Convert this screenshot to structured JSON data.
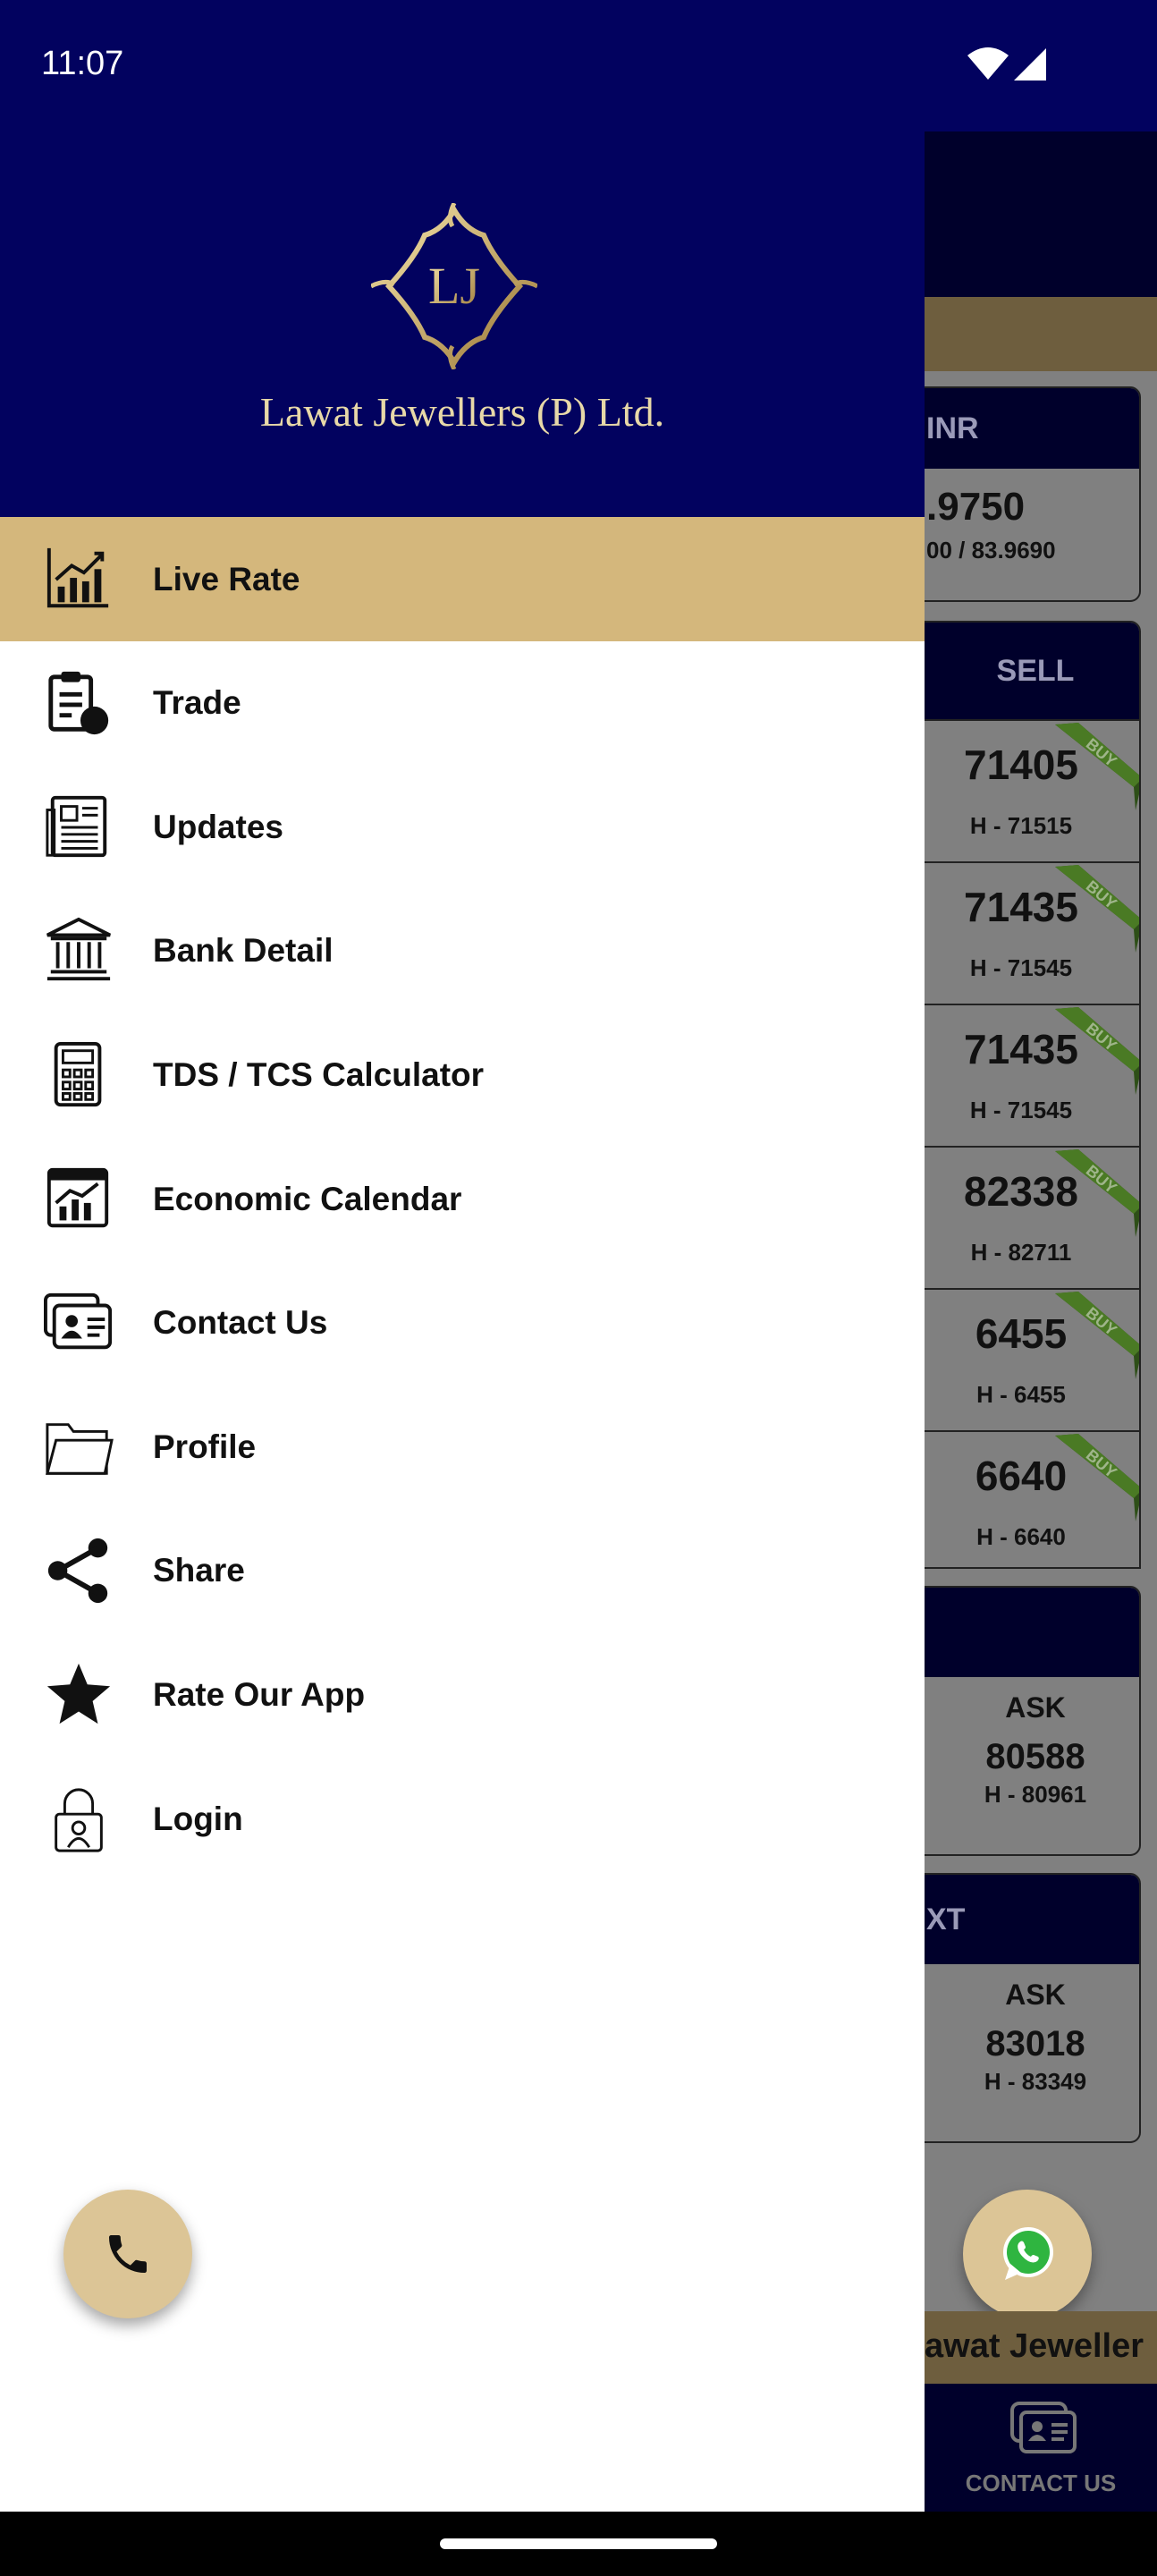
{
  "status_bar": {
    "time": "11:07",
    "icons": [
      "wifi-icon",
      "signal-icon"
    ]
  },
  "drawer": {
    "brand_name": "Lawat Jewellers (P) Ltd.",
    "logo_monogram": "LJ",
    "items": [
      {
        "label": "Live Rate",
        "icon": "chart-icon",
        "active": true
      },
      {
        "label": "Trade",
        "icon": "clipboard-chart-icon"
      },
      {
        "label": "Updates",
        "icon": "newspaper-icon"
      },
      {
        "label": "Bank Detail",
        "icon": "bank-icon"
      },
      {
        "label": "TDS / TCS Calculator",
        "icon": "calculator-icon"
      },
      {
        "label": "Economic Calendar",
        "icon": "calendar-chart-icon"
      },
      {
        "label": "Contact Us",
        "icon": "contact-card-icon"
      },
      {
        "label": "Profile",
        "icon": "folder-icon"
      },
      {
        "label": "Share",
        "icon": "share-icon"
      },
      {
        "label": "Rate Our App",
        "icon": "star-icon"
      },
      {
        "label": "Login",
        "icon": "lock-user-icon"
      }
    ]
  },
  "background": {
    "inr_card": {
      "header": "INR",
      "rate": ".9750",
      "range": "00 / 83.9690"
    },
    "sell_card": {
      "header": "SELL",
      "ribbon": "BUY",
      "rows": [
        {
          "price": "71405",
          "high": "H - 71515"
        },
        {
          "price": "71435",
          "high": "H - 71545"
        },
        {
          "price": "71435",
          "high": "H - 71545"
        },
        {
          "price": "82338",
          "high": "H - 82711"
        },
        {
          "price": "6455",
          "high": "H - 6455"
        },
        {
          "price": "6640",
          "high": "H - 6640"
        }
      ]
    },
    "ask_card_1": {
      "header": "",
      "label": "ASK",
      "price": "80588",
      "high": "H - 80961"
    },
    "ask_card_2": {
      "header": "XT",
      "label": "ASK",
      "price": "83018",
      "high": "H - 83349"
    },
    "marquee": "awat Jeweller",
    "bottom_nav": {
      "label": "CONTACT US"
    }
  },
  "colors": {
    "primary": "#02025f",
    "accent": "#d4b77c",
    "fab": "#dcc596"
  }
}
